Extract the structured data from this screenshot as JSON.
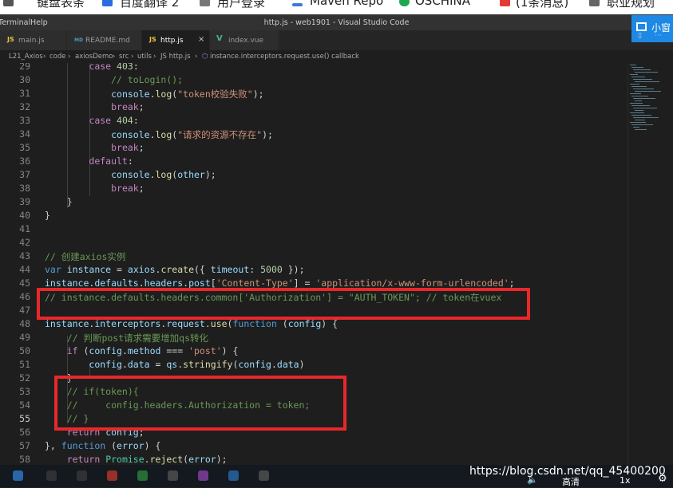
{
  "bookmarks": [
    "键盘表条",
    "百度翻译 2",
    "用户登录",
    "Maven Repo",
    "OSCHINA",
    "(1条消息)",
    "职业规划"
  ],
  "menu": [
    "Terminal",
    "Help"
  ],
  "window_title": "http.js - web1901 - Visual Studio Code",
  "pip_label": "小窗",
  "tabs": [
    {
      "icon": "JS",
      "label": "main.js"
    },
    {
      "icon": "MD",
      "label": "README.md"
    },
    {
      "icon": "JS",
      "label": "http.js"
    },
    {
      "icon": "V",
      "label": "index.vue"
    }
  ],
  "close_glyph": "×",
  "breadcrumb": [
    "L21_Axios",
    "code",
    "axiosDemo",
    "src",
    "utils",
    "JS http.js",
    "instance.interceptors.request.use() callback"
  ],
  "line_numbers": [
    "29",
    "30",
    "31",
    "32",
    "33",
    "34",
    "35",
    "36",
    "37",
    "38",
    "39",
    "40",
    "41",
    "42",
    "43",
    "44",
    "45",
    "46",
    "47",
    "48",
    "49",
    "50",
    "51",
    "52",
    "53",
    "54",
    "55",
    "56",
    "57",
    "58"
  ],
  "current_line": "55",
  "code_lines": [
    "        case 403:",
    "            // toLogin();",
    "            console.log(\"token校验失败\");",
    "            break;",
    "        case 404:",
    "            console.log(\"请求的资源不存在\");",
    "            break;",
    "        default:",
    "            console.log(other);",
    "            break;",
    "    }",
    "}",
    "",
    "",
    "// 创建axios实例",
    "var instance = axios.create({ timeout: 5000 });",
    "instance.defaults.headers.post['Content-Type'] = 'application/x-www-form-urlencoded';",
    "// instance.defaults.headers.common['Authorization'] = \"AUTH_TOKEN\"; // token在vuex",
    "",
    "instance.interceptors.request.use(function (config) {",
    "    // 判断post请求需要增加qs转化",
    "    if (config.method === 'post') {",
    "        config.data = qs.stringify(config.data)",
    "    }",
    "    // if(token){",
    "    //     config.headers.Authorization = token;",
    "    // }",
    "    return config;",
    "}, function (error) {",
    "    return Promise.reject(error);"
  ],
  "taskbar": {
    "watermark": "https://blog.csdn.net/qq_45400200",
    "quality": "高清",
    "speed": "1x"
  },
  "colors": {
    "editor_bg": "#1e1e1e",
    "highlight_box": "#e8282b",
    "comment": "#6a9955",
    "keyword": "#569cd6",
    "string": "#ce9178"
  }
}
